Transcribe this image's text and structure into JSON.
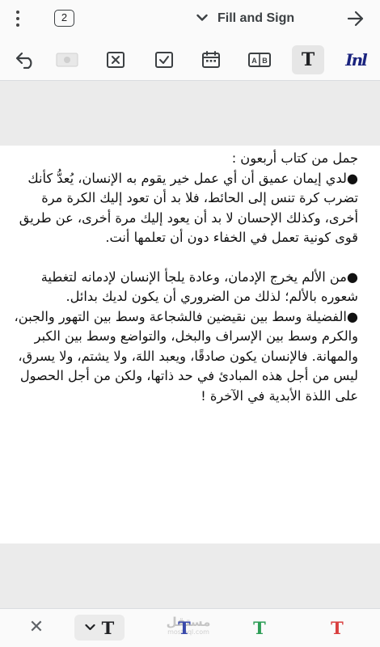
{
  "header": {
    "page_count": "2",
    "mode_label": "Fill and Sign"
  },
  "toolbar": {
    "tools": [
      "undo-icon",
      "eraser-icon",
      "cross-mark-icon",
      "check-mark-icon",
      "date-icon",
      "comb-field-icon",
      "text-tool-icon",
      "signature-icon"
    ],
    "text_tool_glyph": "T",
    "signature_glyph": "Inl"
  },
  "document": {
    "paragraphs": [
      "جمل من كتاب أربعون :",
      "●لدي إيمان عميق أن أي عمل خير يقوم به الإنسان، يُعدُّ كأنك تضرب كرة تنس إلى الحائط، فلا بد أن تعود إليك الكرة مرة أخرى، وكذلك الإحسان لا بد أن يعود إليك مرة أخرى، عن طريق قوى كونية تعمل في الخفاء دون أن تعلمها أنت.",
      "●من الألم يخرج الإدمان، وعادة يلجأ الإنسان لإدمانه لتغطية شعوره بالألم؛ لذلك من الضروري أن يكون لديك بدائل.",
      "●الفضيلة وسط بين نقيضين فالشجاعة وسط بين التهور والجبن، والكرم وسط بين الإسراف والبخل، والتواضع وسط بين الكبر والمهانة. فالإنسان يكون صادقًا، ويعبد اللهَ، ولا يشتم، ولا يسرق، ليس من أجل هذه المبادئ في حد ذاتها، ولكن من أجل الحصول على اللذة الأبدية في الآخرة !"
    ]
  },
  "bottom_bar": {
    "style_glyph": "T",
    "colors": [
      {
        "name": "blue",
        "hex": "#3949ab",
        "glyph": "T"
      },
      {
        "name": "green",
        "hex": "#2e9e57",
        "glyph": "T"
      },
      {
        "name": "red",
        "hex": "#d93f3f",
        "glyph": "T"
      }
    ],
    "watermark": {
      "text": "مستقل",
      "sub": "mostaql.com"
    }
  }
}
